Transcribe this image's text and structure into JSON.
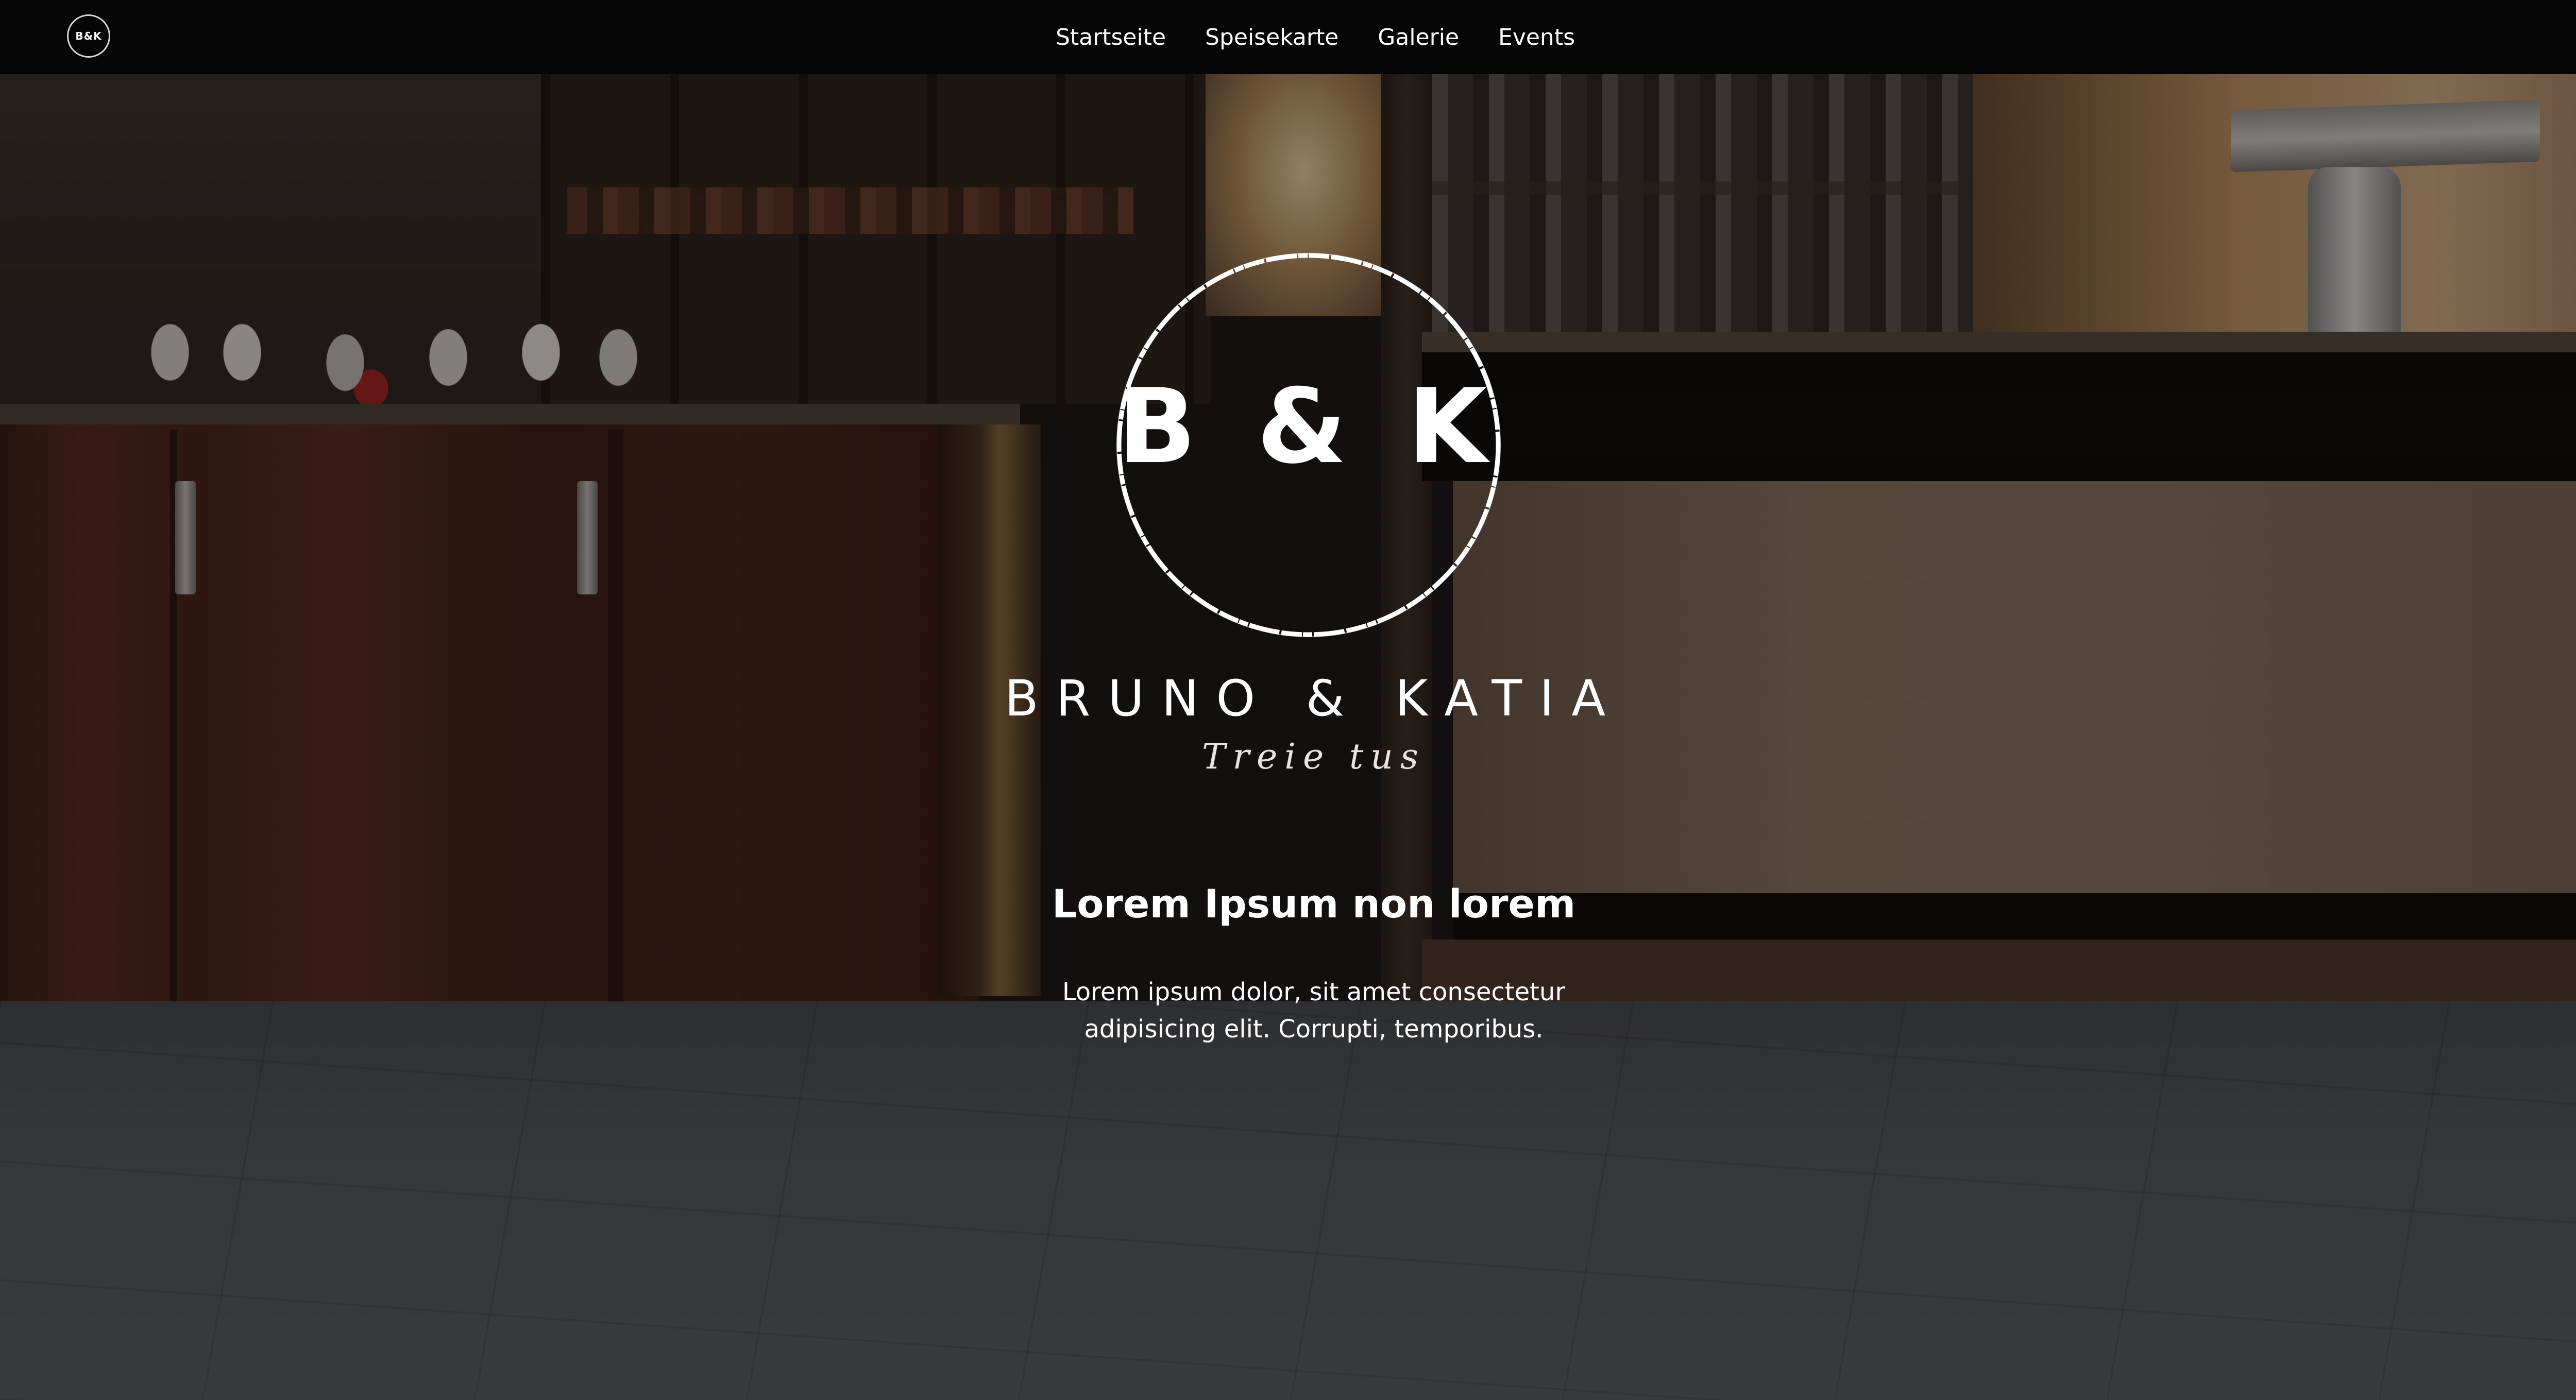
{
  "navbar": {
    "logo_text": "B&K",
    "links": [
      {
        "label": "Startseite"
      },
      {
        "label": "Speisekarte"
      },
      {
        "label": "Galerie"
      },
      {
        "label": "Events"
      }
    ]
  },
  "hero": {
    "emblem_text": "B & K",
    "brand_name": "BRUNO & KATIA",
    "tagline": "Treie tus",
    "heading": "Lorem Ipsum non lorem",
    "body_line1": "Lorem ipsum dolor, sit amet consectetur",
    "body_line2": "adipisicing elit. Corrupti, temporibus."
  },
  "colors": {
    "navbar_bg": "#050505",
    "text": "#ffffff",
    "overlay": "#0a0808"
  },
  "icons": {
    "logo": "circle-monogram-icon"
  }
}
